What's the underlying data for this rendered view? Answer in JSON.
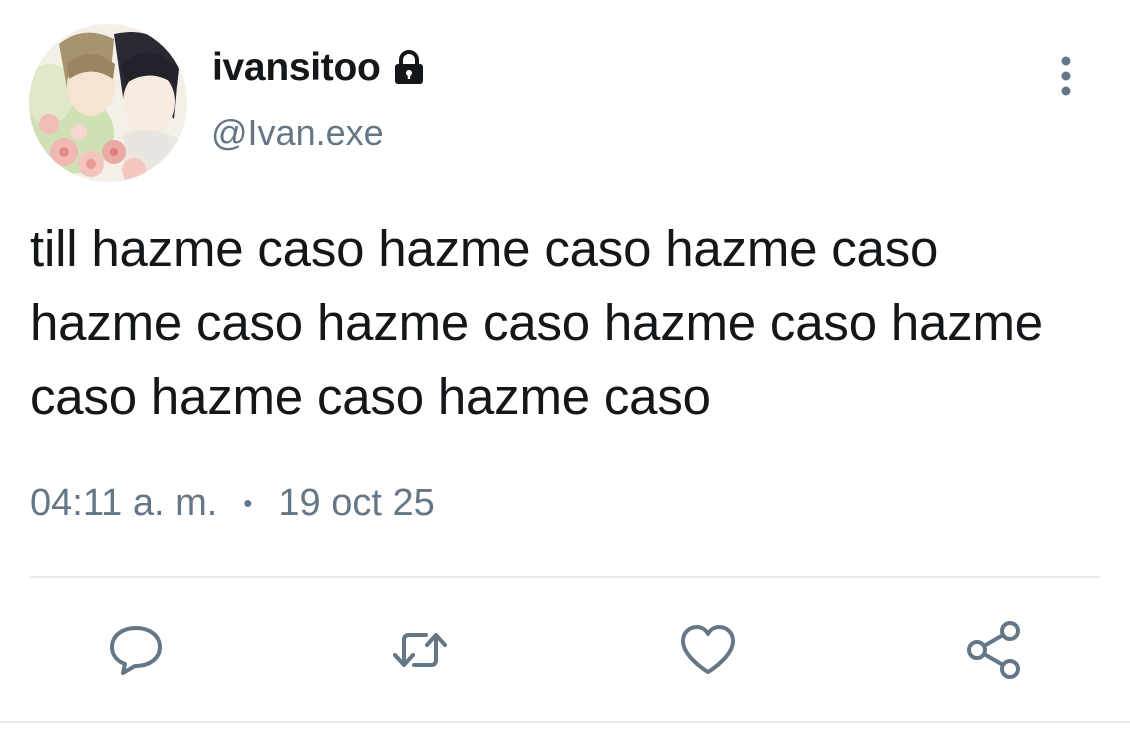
{
  "user": {
    "display_name": "ivansitoo",
    "handle": "@Ivan.exe",
    "protected_icon": "lock-icon",
    "avatar_icon": "profile-avatar"
  },
  "tweet": {
    "text": "till hazme caso hazme caso hazme caso hazme caso hazme caso hazme caso hazme caso hazme caso hazme caso",
    "time": "04:11 a. m.",
    "separator": "•",
    "date": "19 oct 25"
  },
  "actions": {
    "reply_icon": "reply-icon",
    "retweet_icon": "retweet-icon",
    "like_icon": "heart-icon",
    "share_icon": "share-icon",
    "more_icon": "more-vertical-icon"
  },
  "colors": {
    "text_primary": "#14171a",
    "text_secondary": "#657786",
    "icon": "#657786",
    "divider": "#e6ecf0"
  }
}
